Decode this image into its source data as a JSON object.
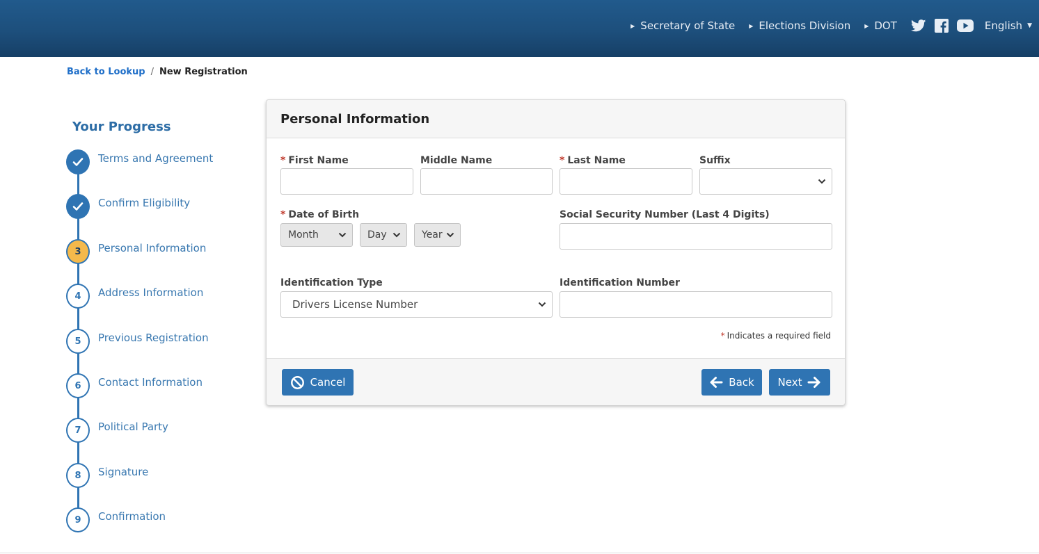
{
  "header": {
    "links": [
      {
        "label": "Secretary of State"
      },
      {
        "label": "Elections Division"
      },
      {
        "label": "DOT"
      }
    ],
    "social_icons": [
      "twitter-icon",
      "facebook-icon",
      "youtube-icon"
    ],
    "language": "English"
  },
  "breadcrumb": {
    "back_link": "Back to Lookup",
    "separator": "/",
    "current": "New Registration"
  },
  "progress": {
    "title": "Your Progress",
    "steps": [
      {
        "number": "1",
        "label": "Terms and Agreement",
        "status": "complete"
      },
      {
        "number": "2",
        "label": "Confirm Eligibility",
        "status": "complete"
      },
      {
        "number": "3",
        "label": "Personal Information",
        "status": "current"
      },
      {
        "number": "4",
        "label": "Address Information",
        "status": "pending"
      },
      {
        "number": "5",
        "label": "Previous Registration",
        "status": "pending"
      },
      {
        "number": "6",
        "label": "Contact Information",
        "status": "pending"
      },
      {
        "number": "7",
        "label": "Political Party",
        "status": "pending"
      },
      {
        "number": "8",
        "label": "Signature",
        "status": "pending"
      },
      {
        "number": "9",
        "label": "Confirmation",
        "status": "pending"
      }
    ]
  },
  "form": {
    "title": "Personal Information",
    "required_marker": "*",
    "first_name": {
      "label": "First Name",
      "value": ""
    },
    "middle_name": {
      "label": "Middle Name",
      "value": ""
    },
    "last_name": {
      "label": "Last Name",
      "value": ""
    },
    "suffix": {
      "label": "Suffix",
      "value": ""
    },
    "dob": {
      "label": "Date of Birth",
      "month": "Month",
      "day": "Day",
      "year": "Year"
    },
    "ssn": {
      "label": "Social Security Number (Last 4 Digits)",
      "value": ""
    },
    "id_type": {
      "label": "Identification Type",
      "value": "Drivers License Number"
    },
    "id_number": {
      "label": "Identification Number",
      "value": ""
    },
    "required_note": "Indicates a required field"
  },
  "buttons": {
    "cancel": "Cancel",
    "back": "Back",
    "next": "Next"
  },
  "colors": {
    "header_bg": "#1d4f7c",
    "accent": "#2f74b3",
    "current_step": "#f5b94b",
    "required": "#c0392b"
  }
}
